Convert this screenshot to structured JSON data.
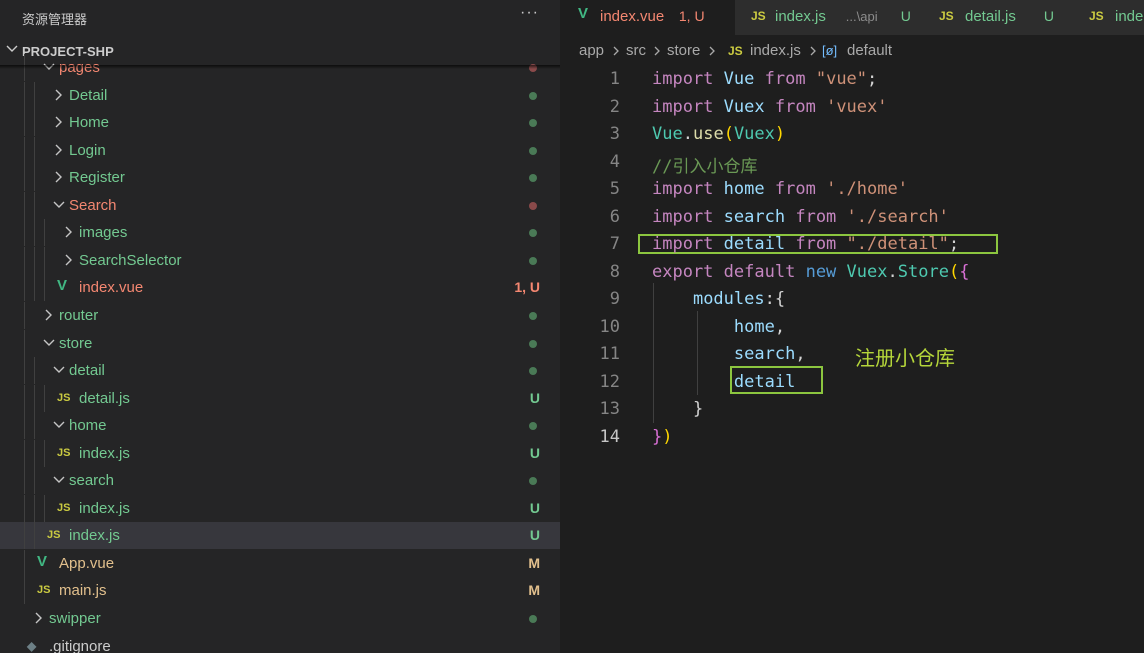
{
  "sidebar": {
    "title": "资源管理器",
    "more": "···",
    "project": "PROJECT-SHP",
    "tree": [
      {
        "label": "pages",
        "kind": "folder",
        "open": true,
        "indent": 1,
        "color": "#f48771",
        "dot": "#8a4a4a"
      },
      {
        "label": "Detail",
        "kind": "folder",
        "open": false,
        "indent": 2,
        "color": "#73c991",
        "dot": "#4a7a56"
      },
      {
        "label": "Home",
        "kind": "folder",
        "open": false,
        "indent": 2,
        "color": "#73c991",
        "dot": "#4a7a56"
      },
      {
        "label": "Login",
        "kind": "folder",
        "open": false,
        "indent": 2,
        "color": "#73c991",
        "dot": "#4a7a56"
      },
      {
        "label": "Register",
        "kind": "folder",
        "open": false,
        "indent": 2,
        "color": "#73c991",
        "dot": "#4a7a56"
      },
      {
        "label": "Search",
        "kind": "folder",
        "open": true,
        "indent": 2,
        "color": "#f48771",
        "dot": "#8a4a4a"
      },
      {
        "label": "images",
        "kind": "folder",
        "open": false,
        "indent": 3,
        "color": "#73c991",
        "dot": "#4a7a56"
      },
      {
        "label": "SearchSelector",
        "kind": "folder",
        "open": false,
        "indent": 3,
        "color": "#73c991",
        "dot": "#4a7a56"
      },
      {
        "label": "index.vue",
        "kind": "vue",
        "indent": 3,
        "color": "#f48771",
        "badge": "1, U",
        "badgeColor": "#f48771"
      },
      {
        "label": "router",
        "kind": "folder",
        "open": false,
        "indent": 1,
        "color": "#73c991",
        "dot": "#4a7a56"
      },
      {
        "label": "store",
        "kind": "folder",
        "open": true,
        "indent": 1,
        "color": "#73c991",
        "dot": "#4a7a56"
      },
      {
        "label": "detail",
        "kind": "folder",
        "open": true,
        "indent": 2,
        "color": "#73c991",
        "dot": "#4a7a56"
      },
      {
        "label": "detail.js",
        "kind": "js",
        "indent": 3,
        "color": "#73c991",
        "badge": "U",
        "badgeColor": "#73c991"
      },
      {
        "label": "home",
        "kind": "folder",
        "open": true,
        "indent": 2,
        "color": "#73c991",
        "dot": "#4a7a56"
      },
      {
        "label": "index.js",
        "kind": "js",
        "indent": 3,
        "color": "#73c991",
        "badge": "U",
        "badgeColor": "#73c991"
      },
      {
        "label": "search",
        "kind": "folder",
        "open": true,
        "indent": 2,
        "color": "#73c991",
        "dot": "#4a7a56"
      },
      {
        "label": "index.js",
        "kind": "js",
        "indent": 3,
        "color": "#73c991",
        "badge": "U",
        "badgeColor": "#73c991"
      },
      {
        "label": "index.js",
        "kind": "js",
        "indent": 2,
        "color": "#73c991",
        "badge": "U",
        "badgeColor": "#73c991",
        "selected": true
      },
      {
        "label": "App.vue",
        "kind": "vue",
        "indent": 1,
        "color": "#e2c08d",
        "badge": "M",
        "badgeColor": "#e2c08d"
      },
      {
        "label": "main.js",
        "kind": "js",
        "indent": 1,
        "color": "#e2c08d",
        "badge": "M",
        "badgeColor": "#e2c08d"
      },
      {
        "label": "swipper",
        "kind": "folder",
        "open": false,
        "indent": 0,
        "color": "#73c991",
        "dot": "#4a7a56"
      },
      {
        "label": ".gitignore",
        "kind": "git",
        "indent": 0,
        "color": "#cccccc"
      }
    ]
  },
  "tabs": [
    {
      "name": "index.vue",
      "icon": "V",
      "desc": "",
      "status": "1, U",
      "nameColor": "#f48771",
      "statusColor": "#f48771",
      "active": true
    },
    {
      "name": "index.js",
      "icon": "JS",
      "desc": "...\\api",
      "status": "U",
      "nameColor": "#73c991",
      "statusColor": "#73c991",
      "active": false
    },
    {
      "name": "detail.js",
      "icon": "JS",
      "desc": "",
      "status": "U",
      "nameColor": "#73c991",
      "statusColor": "#73c991",
      "active": false
    },
    {
      "name": "inde",
      "icon": "JS",
      "desc": "",
      "status": "",
      "nameColor": "#73c991",
      "statusColor": "#73c991",
      "active": false
    }
  ],
  "breadcrumbs": {
    "app": "app",
    "src": "src",
    "store": "store",
    "js_icon": "JS",
    "file": "index.js",
    "symbol_icon": "[ø]",
    "symbol": "default"
  },
  "code": [
    [
      [
        "k1",
        "import"
      ],
      [
        "p",
        " "
      ],
      [
        "v",
        "Vue"
      ],
      [
        "p",
        " "
      ],
      [
        "k1",
        "from"
      ],
      [
        "p",
        " "
      ],
      [
        "s",
        "\"vue\""
      ],
      [
        "p",
        ";"
      ]
    ],
    [
      [
        "k1",
        "import"
      ],
      [
        "p",
        " "
      ],
      [
        "v",
        "Vuex"
      ],
      [
        "p",
        " "
      ],
      [
        "k1",
        "from"
      ],
      [
        "p",
        " "
      ],
      [
        "s",
        "'vuex'"
      ]
    ],
    [
      [
        "t",
        "Vue"
      ],
      [
        "p",
        "."
      ],
      [
        "f",
        "use"
      ],
      [
        "br",
        "("
      ],
      [
        "t",
        "Vuex"
      ],
      [
        "br",
        ")"
      ]
    ],
    [
      [
        "c",
        "//引入小仓库"
      ]
    ],
    [
      [
        "k1",
        "import"
      ],
      [
        "p",
        " "
      ],
      [
        "v",
        "home"
      ],
      [
        "p",
        " "
      ],
      [
        "k1",
        "from"
      ],
      [
        "p",
        " "
      ],
      [
        "s",
        "'./home'"
      ]
    ],
    [
      [
        "k1",
        "import"
      ],
      [
        "p",
        " "
      ],
      [
        "v",
        "search"
      ],
      [
        "p",
        " "
      ],
      [
        "k1",
        "from"
      ],
      [
        "p",
        " "
      ],
      [
        "s",
        "'./search'"
      ]
    ],
    [
      [
        "k1",
        "import"
      ],
      [
        "p",
        " "
      ],
      [
        "v",
        "detail"
      ],
      [
        "p",
        " "
      ],
      [
        "k1",
        "from"
      ],
      [
        "p",
        " "
      ],
      [
        "s",
        "\"./detail\""
      ],
      [
        "p",
        ";"
      ]
    ],
    [
      [
        "k1",
        "export"
      ],
      [
        "p",
        " "
      ],
      [
        "k1",
        "default"
      ],
      [
        "p",
        " "
      ],
      [
        "k2",
        "new"
      ],
      [
        "p",
        " "
      ],
      [
        "t",
        "Vuex"
      ],
      [
        "p",
        "."
      ],
      [
        "t",
        "Store"
      ],
      [
        "br",
        "("
      ],
      [
        "br2",
        "{"
      ]
    ],
    [
      [
        "p",
        "    "
      ],
      [
        "v",
        "modules"
      ],
      [
        "p",
        ":{"
      ]
    ],
    [
      [
        "p",
        "        "
      ],
      [
        "v",
        "home"
      ],
      [
        "p",
        ","
      ]
    ],
    [
      [
        "p",
        "        "
      ],
      [
        "v",
        "search"
      ],
      [
        "p",
        ","
      ]
    ],
    [
      [
        "p",
        "        "
      ],
      [
        "v",
        "detail"
      ]
    ],
    [
      [
        "p",
        "    "
      ],
      [
        "p",
        "}"
      ]
    ],
    [
      [
        "br2",
        "}"
      ],
      [
        "br",
        ")"
      ]
    ]
  ],
  "current_line": 14,
  "annotation": "注册小仓库"
}
